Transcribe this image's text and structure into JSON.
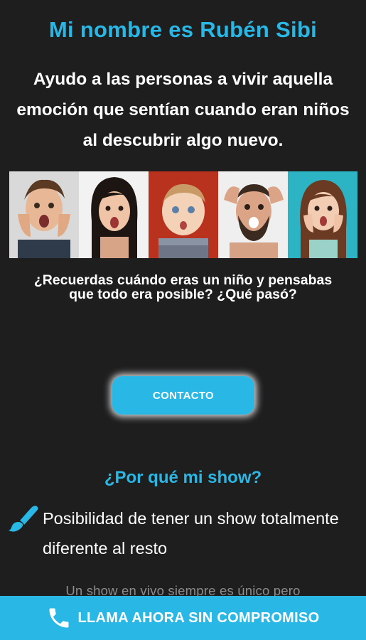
{
  "header": {
    "title": "Mi nombre es Rubén Sibi",
    "headline": "Ayudo a las personas a vivir aquella emoción que sentían cuando eran niños al descubrir algo nuevo."
  },
  "question": "¿Recuerdas cuándo eras un niño y pensabas que todo era posible? ¿Qué pasó?",
  "contact_button": "CONTACTO",
  "why_section": {
    "title": "¿Por qué mi show?",
    "feature_text": "Posibilidad de tener un show totalmente diferente al resto",
    "sub_text": "Un show en vivo siempre es único pero"
  },
  "call_bar": {
    "label": "LLAMA AHORA SIN COMPROMISO",
    "icon": "phone-icon"
  },
  "brush_icon": "paintbrush-icon",
  "colors": {
    "accent": "#29b8e6",
    "background": "#1e1e1f"
  }
}
